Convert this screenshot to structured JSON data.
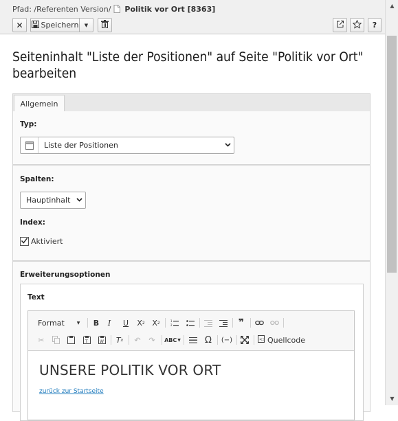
{
  "header": {
    "path_label": "Pfad: /Referenten Version/",
    "page_title": "Politik vor Ort [8363]",
    "save_label": "Speichern"
  },
  "main": {
    "heading": "Seiteninhalt \"Liste der Positionen\" auf Seite \"Politik vor Ort\" bearbeiten",
    "tabs": [
      {
        "label": "Allgemein",
        "active": true
      }
    ],
    "type": {
      "label": "Typ:",
      "value": "Liste der Positionen"
    },
    "columns": {
      "label": "Spalten:",
      "value": "Hauptinhalt"
    },
    "index": {
      "label": "Index:",
      "checkbox_label": "Aktiviert",
      "checked": true
    },
    "extension": {
      "label": "Erweiterungsoptionen",
      "text_label": "Text",
      "editor": {
        "format_label": "Format",
        "source_label": "Quellcode",
        "content_heading": "UNSERE POLITIK VOR ORT",
        "content_link": "zurück zur Startseite"
      }
    }
  },
  "colors": {
    "link": "#1f7bbd",
    "toolbar_bg": "#f0f0f0",
    "scroll_thumb": "#c1c1c1"
  }
}
